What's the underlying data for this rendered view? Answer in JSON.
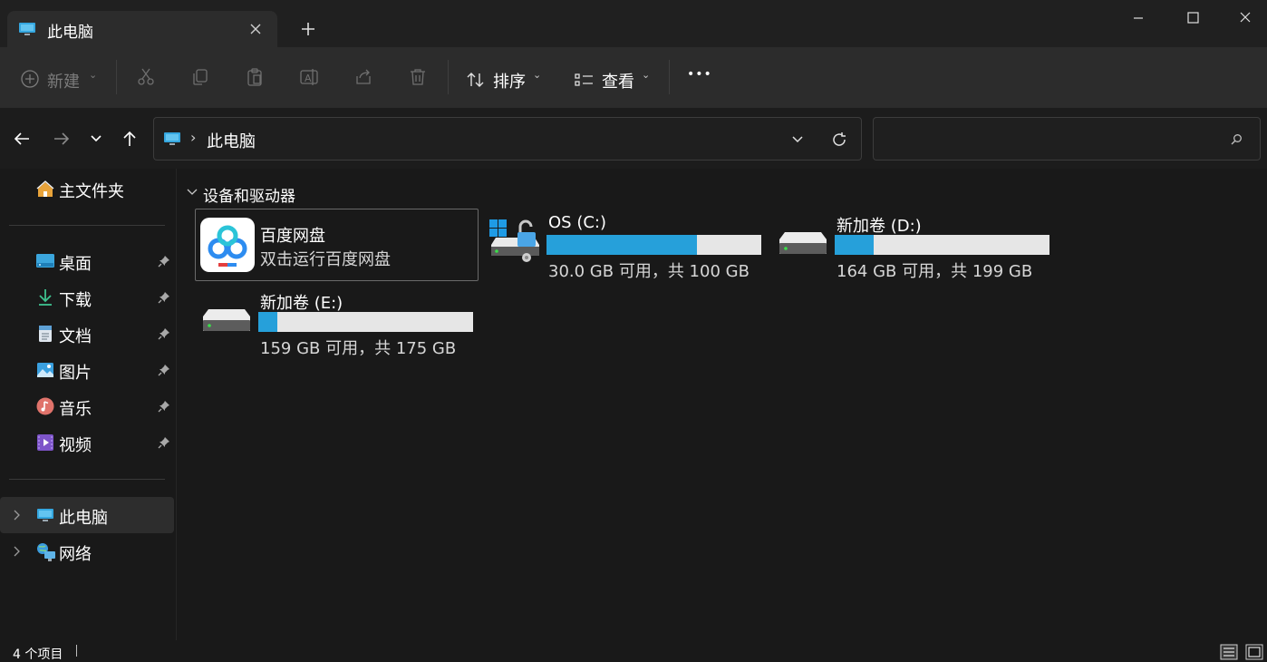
{
  "window": {
    "tab_title": "此电脑",
    "new_tab_symbol": "+"
  },
  "toolbar": {
    "new_label": "新建",
    "sort_label": "排序",
    "view_label": "查看",
    "more_label": "•••"
  },
  "address": {
    "crumb": "此电脑"
  },
  "sidebar": {
    "home": "主文件夹",
    "items": [
      {
        "label": "桌面",
        "icon": "desktop-icon"
      },
      {
        "label": "下载",
        "icon": "download-icon"
      },
      {
        "label": "文档",
        "icon": "document-icon"
      },
      {
        "label": "图片",
        "icon": "pictures-icon"
      },
      {
        "label": "音乐",
        "icon": "music-icon"
      },
      {
        "label": "视频",
        "icon": "video-icon"
      }
    ],
    "this_pc": "此电脑",
    "network": "网络"
  },
  "content": {
    "section_title": "设备和驱动器",
    "baidu": {
      "name": "百度网盘",
      "subtitle": "双击运行百度网盘"
    },
    "drives": [
      {
        "name": "OS (C:)",
        "info": "30.0 GB 可用，共 100 GB",
        "used_fraction": 0.7
      },
      {
        "name": "新加卷 (D:)",
        "info": "164 GB 可用，共 199 GB",
        "used_fraction": 0.18
      },
      {
        "name": "新加卷 (E:)",
        "info": "159 GB 可用，共 175 GB",
        "used_fraction": 0.09
      }
    ]
  },
  "status": {
    "count": "4 个项目"
  },
  "colors": {
    "accent": "#26a0da",
    "background": "#191919",
    "toolbar": "#2c2c2c"
  }
}
